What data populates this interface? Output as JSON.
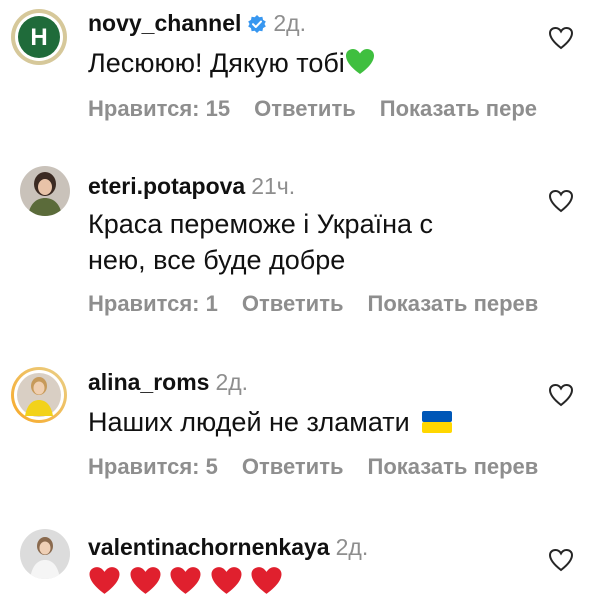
{
  "comments": [
    {
      "username": "novy_channel",
      "verified": true,
      "time": "2д.",
      "text": "Лесююю! Дякую тобі",
      "likes": "Нравится: 15",
      "reply": "Ответить",
      "translate": "Показать пере"
    },
    {
      "username": "eteri.potapova",
      "time": "21ч.",
      "text_line1": "Краса переможе і Україна  с",
      "text_line2": "нею, все буде добре",
      "likes": "Нравится: 1",
      "reply": "Ответить",
      "translate": "Показать перев"
    },
    {
      "username": "alina_roms",
      "time": "2д.",
      "text": "Наших людей не зламати",
      "likes": "Нравится: 5",
      "reply": "Ответить",
      "translate": "Показать перев"
    },
    {
      "username": "valentinachornenkaya",
      "time": "2д."
    }
  ],
  "colors": {
    "meta_gray": "#8e8e8e",
    "verified_blue": "#3897f0",
    "heart_green": "#3fbf3f",
    "heart_red": "#e0202e",
    "flag_blue": "#0057b7",
    "flag_yellow": "#ffd700"
  }
}
